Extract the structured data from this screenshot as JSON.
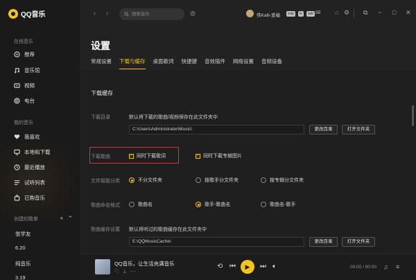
{
  "app": {
    "name": "QQ音乐"
  },
  "sidebar": {
    "online_label": "在线音乐",
    "online_items": [
      {
        "label": "推荐",
        "icon": "recommend-icon"
      },
      {
        "label": "音乐馆",
        "icon": "music-hall-icon"
      },
      {
        "label": "视频",
        "icon": "video-icon"
      },
      {
        "label": "电台",
        "icon": "radio-icon"
      }
    ],
    "my_label": "我的音乐",
    "my_items": [
      {
        "label": "我喜欢",
        "icon": "heart-icon"
      },
      {
        "label": "本地和下载",
        "icon": "monitor-icon"
      },
      {
        "label": "最近播放",
        "icon": "clock-icon"
      },
      {
        "label": "试听列表",
        "icon": "list-icon"
      },
      {
        "label": "已购音乐",
        "icon": "bag-icon"
      }
    ],
    "created_label": "创建的歌单",
    "playlists": [
      "张学友",
      "6.20",
      "纯音乐",
      "3.19"
    ]
  },
  "topbar": {
    "search_placeholder": "搜索音乐",
    "username": "伟Kalli-爱编",
    "badges": [
      "svip",
      "lv",
      "sub"
    ]
  },
  "settings": {
    "title": "设置",
    "tabs": [
      "常规设置",
      "下载与缓存",
      "桌面歌词",
      "快捷键",
      "音效插件",
      "网络设置",
      "音频设备"
    ],
    "active_tab": "下载与缓存",
    "section_title": "下载缓存",
    "download_dir": {
      "label": "下载目录",
      "desc": "默认将下载的歌曲/视频保存在此文件夹中",
      "path": "C:\\Users\\Administrator\\Music\\",
      "change_btn": "更改目录",
      "open_btn": "打开文件夹"
    },
    "download_song": {
      "label": "下载歌曲",
      "opt1": "同时下载歌词",
      "opt2": "同时下载专辑图片"
    },
    "smart_classify": {
      "label": "文件智能分类",
      "options": [
        "不分文件夹",
        "按歌手分文件夹",
        "按专辑分文件夹"
      ],
      "selected_index": 0
    },
    "naming": {
      "label": "歌曲命名格式",
      "options": [
        "歌曲名",
        "歌手-歌曲名",
        "歌曲名-歌手"
      ],
      "selected_index": 1
    },
    "cache": {
      "label": "歌曲缓存设置",
      "desc": "默认将听过的歌曲缓存在此文件夹中",
      "path": "E:\\QQMusicCache\\",
      "change_btn": "更改目录",
      "open_btn": "打开文件夹"
    }
  },
  "player": {
    "song_title": "QQ音乐，让生活充满音乐",
    "time": "00:00 / 00:00"
  },
  "colors": {
    "accent": "#f5c518",
    "highlight": "#e03434",
    "background": "#1f1f1f"
  }
}
